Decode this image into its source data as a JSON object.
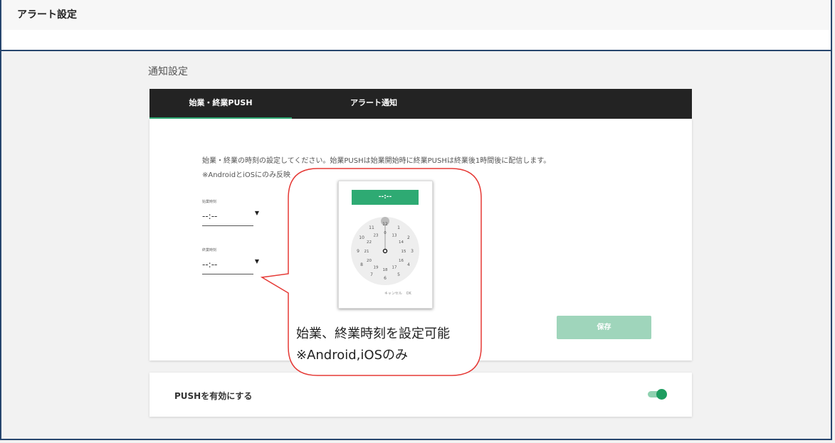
{
  "header": {
    "title": "アラート設定"
  },
  "section": {
    "title": "通知設定"
  },
  "tabs": [
    {
      "label": "始業・終業PUSH",
      "active": true
    },
    {
      "label": "アラート通知",
      "active": false
    }
  ],
  "content": {
    "description": "始業・終業の時刻の設定してください。始業PUSHは始業開始時に終業PUSHは終業後1時間後に配信します。",
    "note": "※AndroidとiOSにのみ反映",
    "start": {
      "label": "始業時刻",
      "value": "--:--"
    },
    "end": {
      "label": "終業時刻",
      "value": "--:--"
    },
    "save_label": "保存"
  },
  "push": {
    "label": "PUSHを有効にする",
    "enabled": true
  },
  "callout": {
    "line1": "始業、終業時刻を設定可能",
    "line2": "※Android,iOSのみ"
  },
  "picker": {
    "display": "--:--",
    "outer": [
      "12",
      "1",
      "2",
      "3",
      "4",
      "5",
      "6",
      "7",
      "8",
      "9",
      "10",
      "11"
    ],
    "inner": [
      "0",
      "13",
      "14",
      "15",
      "16",
      "17",
      "18",
      "19",
      "20",
      "21",
      "22",
      "23"
    ],
    "cancel": "キャンセル",
    "ok": "OK"
  },
  "colors": {
    "accent": "#2eaa73",
    "callout": "#e53935",
    "frame": "#27466e"
  }
}
